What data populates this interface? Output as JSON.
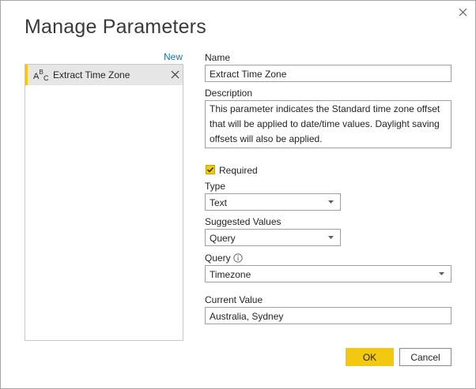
{
  "dialog": {
    "title": "Manage Parameters",
    "close_icon": "close-icon"
  },
  "sidebar": {
    "new_label": "New",
    "items": [
      {
        "label": "Extract Time Zone",
        "icon": "text-type-icon",
        "remove_icon": "remove-icon",
        "selected": true
      }
    ],
    "accent_color": "#f2c811"
  },
  "form": {
    "name_label": "Name",
    "name_value": "Extract Time Zone",
    "description_label": "Description",
    "description_value": "This parameter indicates the Standard time zone offset that will be applied to date/time values. Daylight saving offsets will also be applied.",
    "required_label": "Required",
    "required_checked": true,
    "type_label": "Type",
    "type_value": "Text",
    "suggested_label": "Suggested Values",
    "suggested_value": "Query",
    "query_label": "Query",
    "query_info_icon": "info-icon",
    "query_value": "Timezone",
    "current_label": "Current Value",
    "current_value": "Australia, Sydney"
  },
  "buttons": {
    "ok_label": "OK",
    "cancel_label": "Cancel",
    "ok_color": "#f2c811"
  }
}
